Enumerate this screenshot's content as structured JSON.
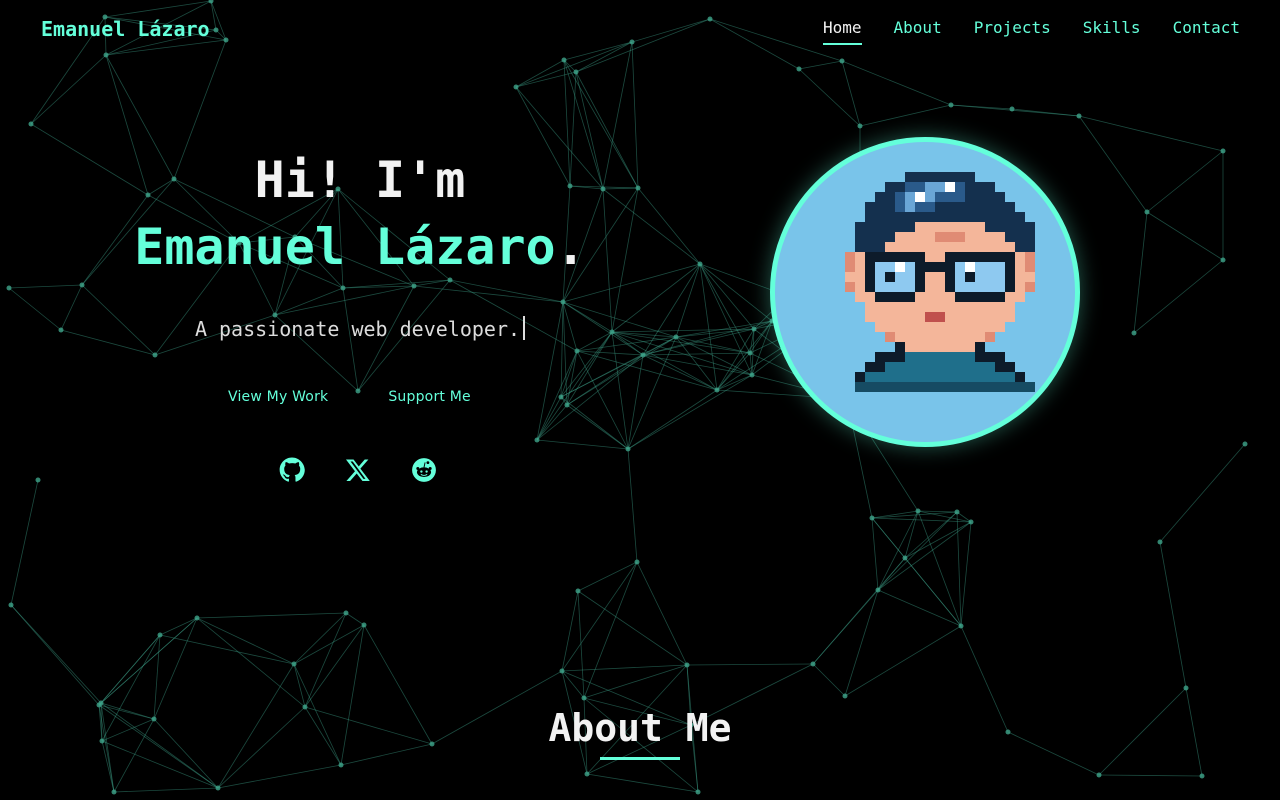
{
  "nav": {
    "brand": "Emanuel Lázaro",
    "links": [
      {
        "label": "Home",
        "active": true
      },
      {
        "label": "About",
        "active": false
      },
      {
        "label": "Projects",
        "active": false
      },
      {
        "label": "Skills",
        "active": false
      },
      {
        "label": "Contact",
        "active": false
      }
    ]
  },
  "hero": {
    "greeting": "Hi! I'm",
    "name": "Emanuel Lázaro",
    "name_suffix": ".",
    "tagline": "A passionate web developer.",
    "cta_primary": "View My Work",
    "cta_secondary": "Support Me",
    "socials": [
      {
        "icon": "github-icon"
      },
      {
        "icon": "x-icon"
      },
      {
        "icon": "reddit-icon"
      }
    ]
  },
  "avatar": {
    "icon": "pixel-avatar"
  },
  "about": {
    "title": "About Me"
  },
  "theme": {
    "accent": "#64ffda",
    "background": "#000000",
    "text": "#f2f2f2"
  }
}
